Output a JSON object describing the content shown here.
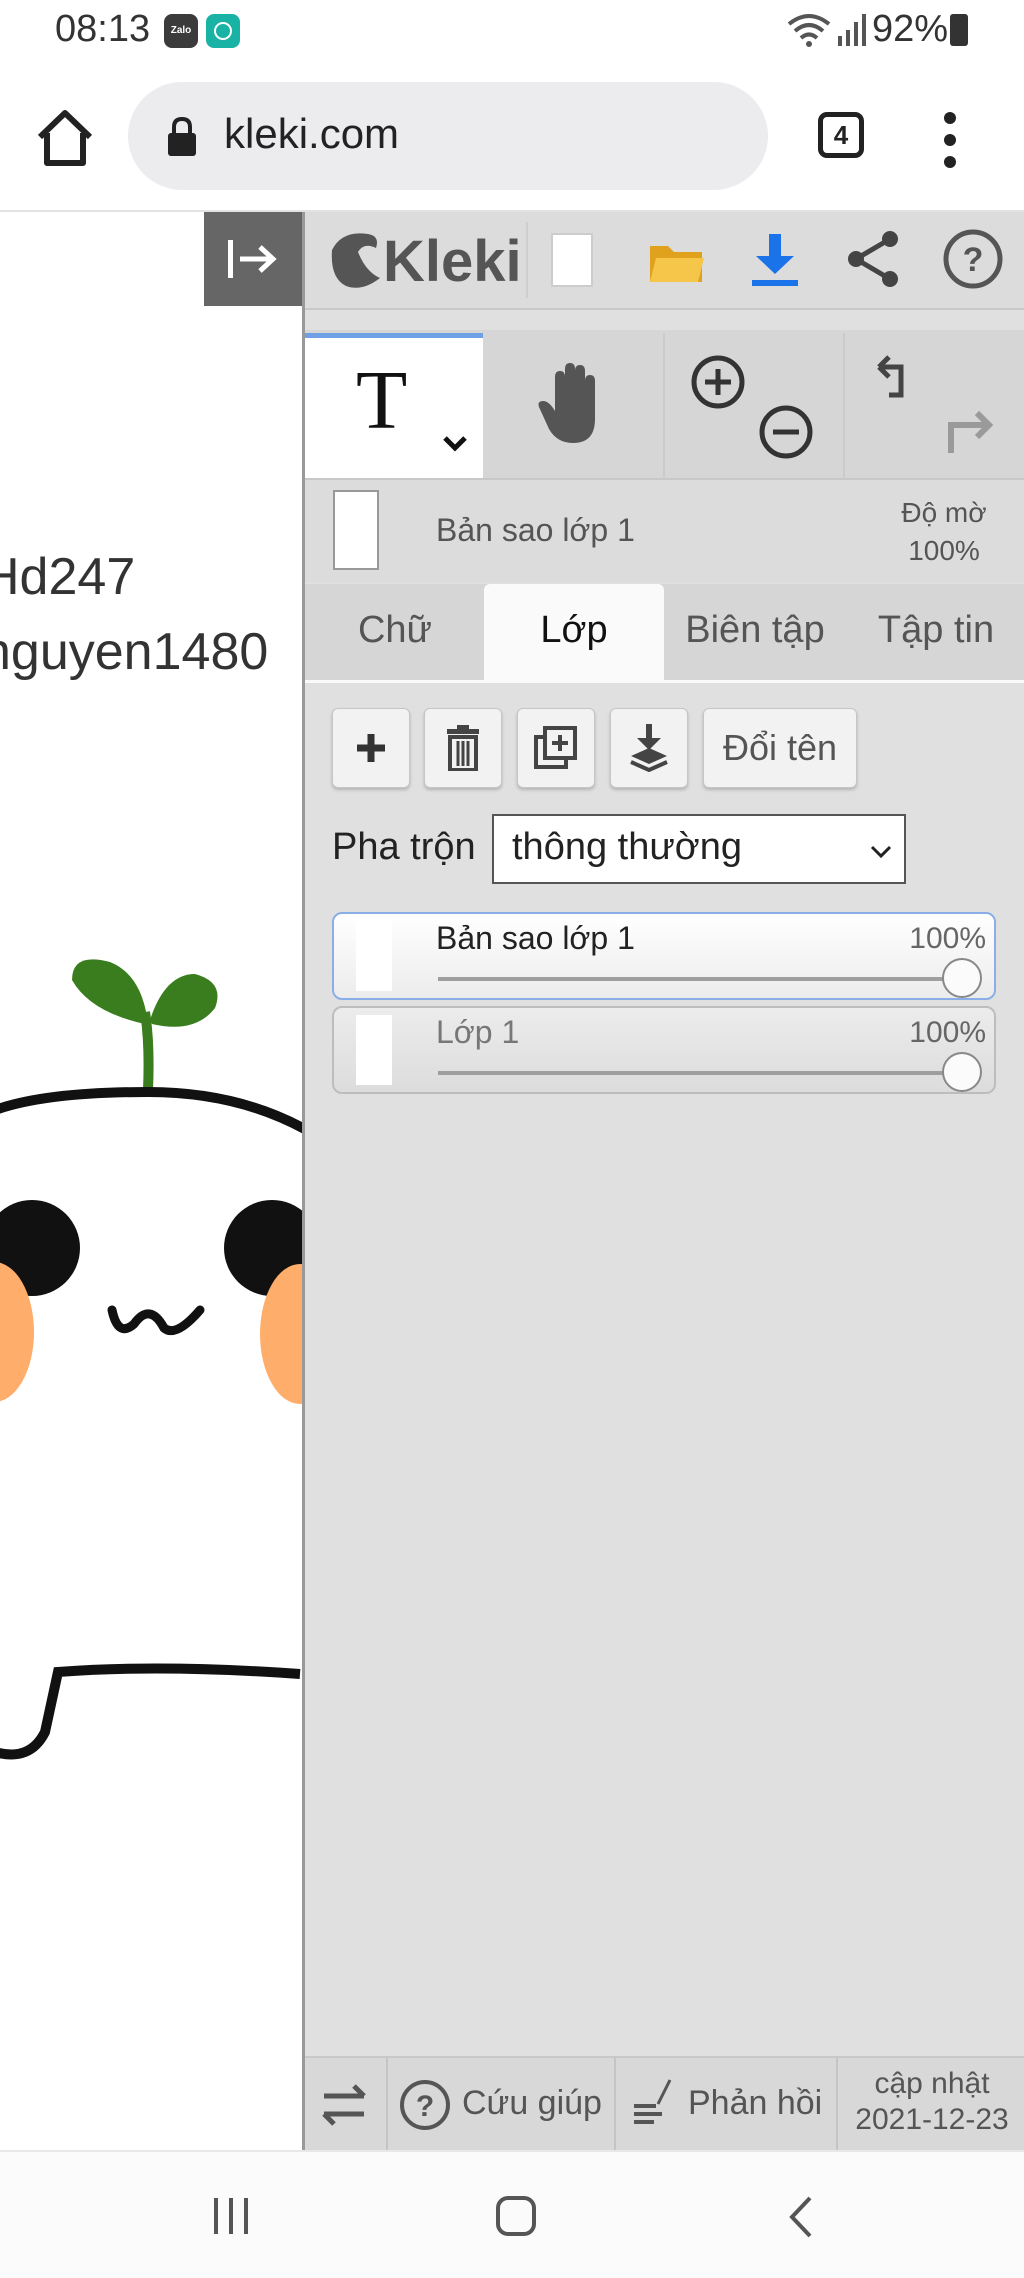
{
  "status_bar": {
    "time": "08:13",
    "notif_app1": "Zalo",
    "battery": "92%"
  },
  "browser": {
    "url": "kleki.com",
    "tab_count": "4"
  },
  "canvas": {
    "line1": "Hd247",
    "line2": "nguyen1480"
  },
  "app": {
    "logo": "Kleki"
  },
  "tools": {
    "text_glyph": "T"
  },
  "layer_info": {
    "name": "Bản sao lớp 1",
    "opacity_label": "Độ mờ",
    "opacity_value": "100%"
  },
  "tabs": [
    {
      "label": "Chữ"
    },
    {
      "label": "Lớp"
    },
    {
      "label": "Biên tập"
    },
    {
      "label": "Tập tin"
    }
  ],
  "layer_actions": {
    "rename_label": "Đổi tên"
  },
  "blend": {
    "label": "Pha trộn",
    "value": "thông thường"
  },
  "layers": [
    {
      "name": "Bản sao lớp 1",
      "opacity": "100%",
      "opacity_fraction": 1.0
    },
    {
      "name": "Lớp 1",
      "opacity": "100%",
      "opacity_fraction": 1.0
    }
  ],
  "bottom_bar": {
    "help_label": "Cứu giúp",
    "feedback_label": "Phản hồi",
    "update_label": "cập nhật",
    "update_date": "2021-12-23"
  },
  "colors": {
    "accent": "#6fa0e6",
    "download": "#1a73e8",
    "folder": "#f5b82e",
    "leaf": "#3a7d1e",
    "cheek": "#ffad6b"
  }
}
